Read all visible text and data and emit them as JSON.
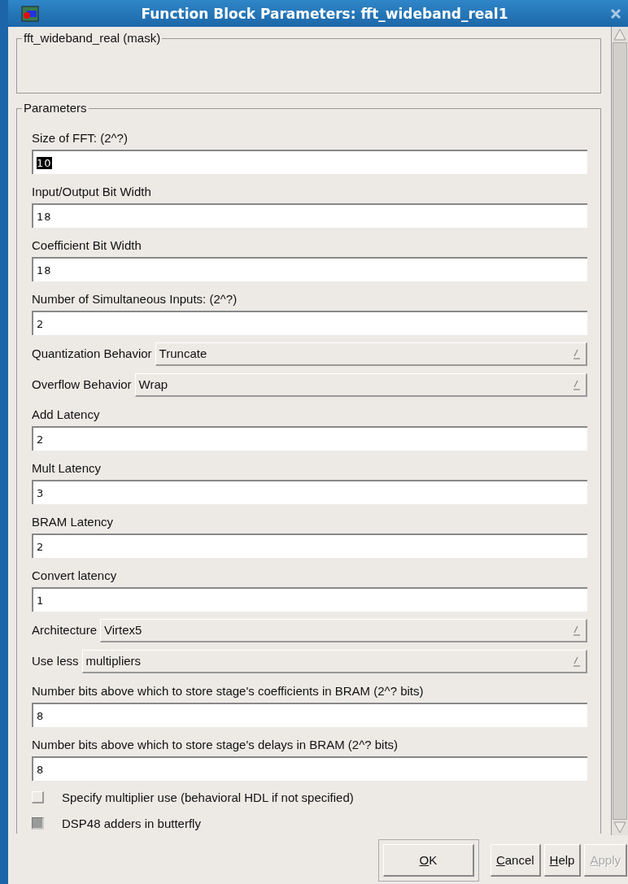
{
  "window": {
    "title": "Function Block Parameters: fft_wideband_real1"
  },
  "mask": {
    "title": "fft_wideband_real (mask)"
  },
  "parameters": {
    "title": "Parameters",
    "items": [
      {
        "kind": "text",
        "label": "Size of FFT: (2^?)",
        "value": "10",
        "highlighted": true
      },
      {
        "kind": "text",
        "label": "Input/Output Bit Width",
        "value": "18",
        "highlighted": false
      },
      {
        "kind": "text",
        "label": "Coefficient Bit Width",
        "value": "18",
        "highlighted": false
      },
      {
        "kind": "text",
        "label": "Number of Simultaneous Inputs: (2^?)",
        "value": "2",
        "highlighted": false
      },
      {
        "kind": "select",
        "label": "Quantization Behavior",
        "value": "Truncate"
      },
      {
        "kind": "select",
        "label": "Overflow Behavior",
        "value": "Wrap"
      },
      {
        "kind": "text",
        "label": "Add Latency",
        "value": "2",
        "highlighted": false
      },
      {
        "kind": "text",
        "label": "Mult Latency",
        "value": "3",
        "highlighted": false
      },
      {
        "kind": "text",
        "label": "BRAM Latency",
        "value": "2",
        "highlighted": false
      },
      {
        "kind": "text",
        "label": "Convert latency",
        "value": "1",
        "highlighted": false
      },
      {
        "kind": "select",
        "label": "Architecture",
        "value": "Virtex5"
      },
      {
        "kind": "select",
        "label": "Use less",
        "value": "multipliers"
      },
      {
        "kind": "text",
        "label": "Number bits above which to store stage's coefficients in BRAM (2^? bits)",
        "value": "8",
        "highlighted": false
      },
      {
        "kind": "text",
        "label": "Number bits above which to store stage's delays in BRAM (2^? bits)",
        "value": "8",
        "highlighted": false
      },
      {
        "kind": "checkbox",
        "label": "Specify multiplier use (behavioral HDL if not specified)",
        "checked": false
      },
      {
        "kind": "checkbox",
        "label": "DSP48 adders in butterfly",
        "checked": true
      }
    ]
  },
  "buttons": [
    {
      "label": "OK",
      "disabled": false
    },
    {
      "label": "Cancel",
      "disabled": false
    },
    {
      "label": "Help",
      "disabled": false
    },
    {
      "label": "Apply",
      "disabled": true
    }
  ]
}
